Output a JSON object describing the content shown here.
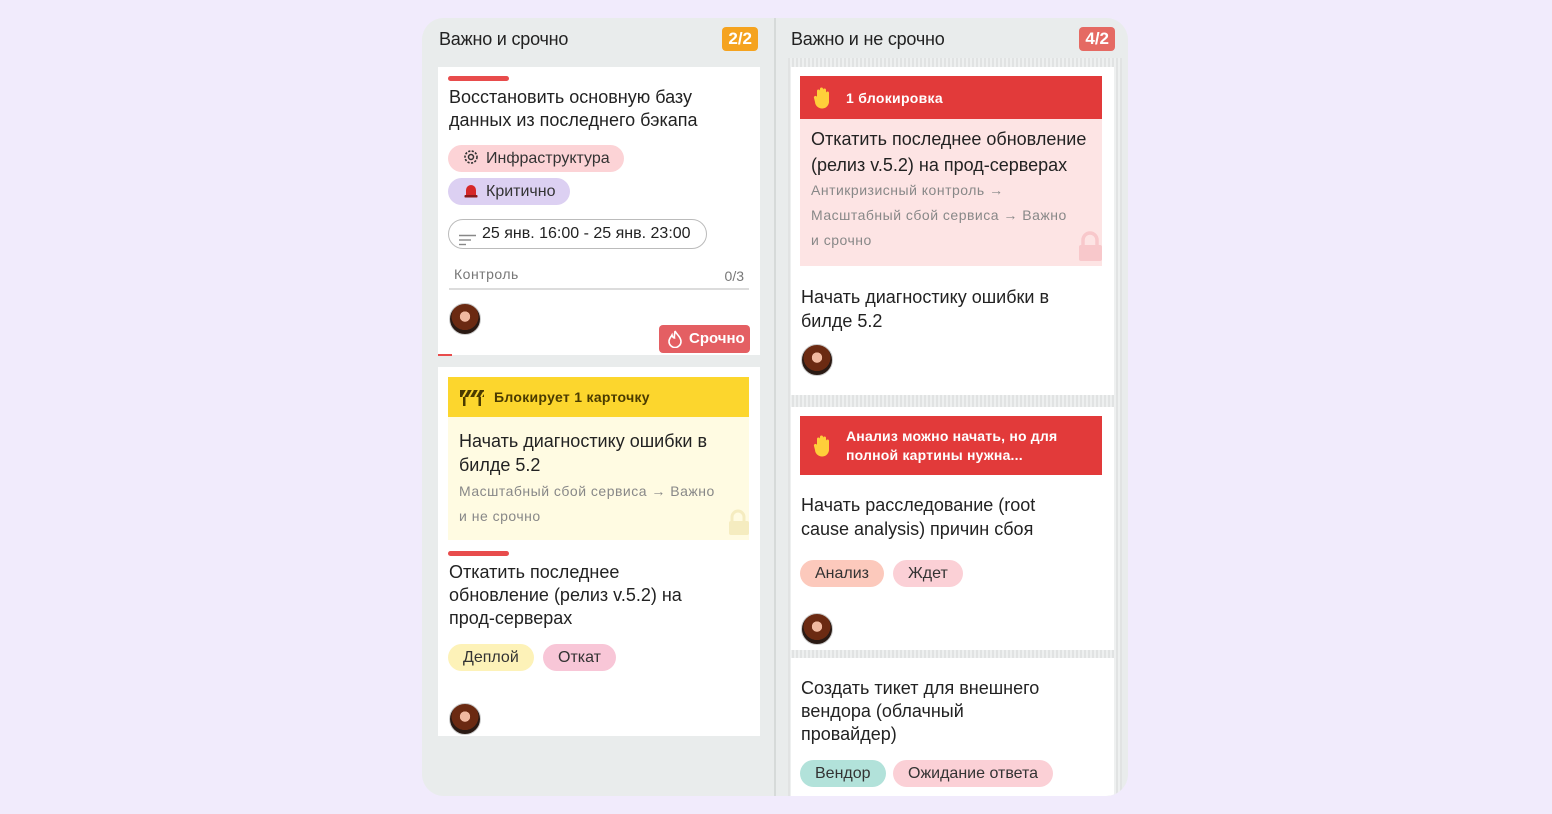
{
  "columns": [
    {
      "title": "Важно и срочно",
      "count": "2/2",
      "cards": [
        {
          "title_l1": "Восстановить основную базу",
          "title_l2": "данных из последнего бэкапа",
          "tags": [
            "Инфраструктура",
            "Критично"
          ],
          "dates": "25 янв. 16:00 - 25 янв. 23:00",
          "checklist_label": "Контроль",
          "checklist_count": "0/3",
          "urgent_label": "Срочно"
        },
        {
          "banner": "Блокирует 1 карточку",
          "blocked_title_l1": "Начать диагностику ошибки в",
          "blocked_title_l2": "билде 5.2",
          "blocked_path_l1": "Масштабный сбой сервиса → Важно",
          "blocked_path_l2": "и не срочно",
          "title_l1": "Откатить последнее",
          "title_l2": "обновление (релиз v.5.2) на",
          "title_l3": "прод-серверах",
          "tags": [
            "Деплой",
            "Откат"
          ]
        }
      ]
    },
    {
      "title": "Важно и не срочно",
      "count": "4/2",
      "cards": [
        {
          "banner": "1 блокировка",
          "blocker_title_l1": "Откатить последнее обновление",
          "blocker_title_l2": "(релиз v.5.2) на прод-серверах",
          "blocker_path_l1": "Антикризисный контроль →",
          "blocker_path_l2": "Масштабный сбой сервиса → Важно",
          "blocker_path_l3": "и срочно",
          "title_l1": "Начать диагностику ошибки в",
          "title_l2": "билде 5.2"
        },
        {
          "banner_l1": "Анализ можно начать, но для",
          "banner_l2": "полной картины нужна...",
          "title_l1": "Начать расследование (root",
          "title_l2": "cause analysis) причин сбоя",
          "tags": [
            "Анализ",
            "Ждет"
          ]
        },
        {
          "title_l1": "Создать тикет для внешнего",
          "title_l2": "вендора (облачный",
          "title_l3": "провайдер)",
          "tags": [
            "Вендор",
            "Ожидание ответа"
          ]
        }
      ]
    }
  ],
  "colors": {
    "board_bg": "#e9ecec",
    "page_bg": "#f1ebfc",
    "red": "#e23a3a",
    "yellow": "#fcd62d",
    "orange": "#f5a31f"
  },
  "icons": [
    "gear-icon",
    "siren-icon",
    "filter-lines-icon",
    "fire-icon",
    "hand-stop-icon",
    "barrier-icon",
    "lock-icon"
  ]
}
